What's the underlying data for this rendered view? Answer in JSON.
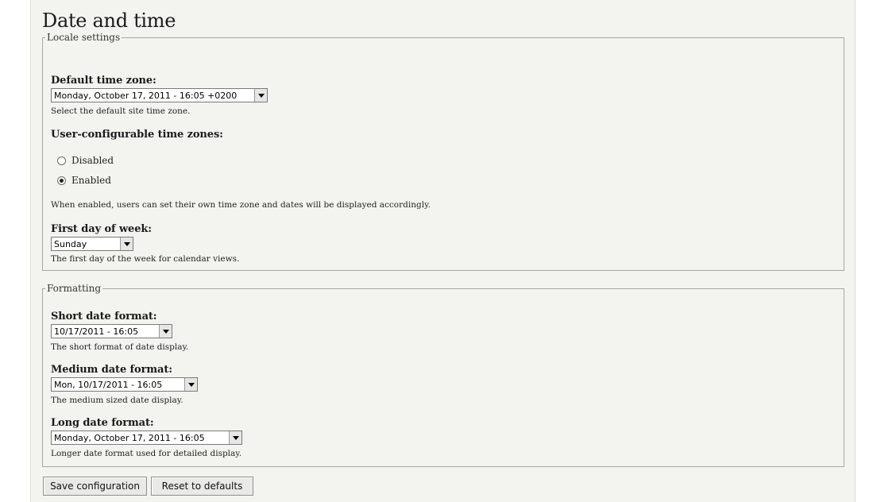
{
  "page": {
    "title": "Date and time"
  },
  "locale": {
    "legend": "Locale settings",
    "default_timezone": {
      "label": "Default time zone:",
      "value": "Monday, October 17, 2011 - 16:05 +0200",
      "description": "Select the default site time zone."
    },
    "user_timezones": {
      "label": "User-configurable time zones:",
      "options": [
        {
          "label": "Disabled",
          "checked": false
        },
        {
          "label": "Enabled",
          "checked": true
        }
      ],
      "description": "When enabled, users can set their own time zone and dates will be displayed accordingly."
    },
    "first_day": {
      "label": "First day of week:",
      "value": "Sunday",
      "description": "The first day of the week for calendar views."
    }
  },
  "formatting": {
    "legend": "Formatting",
    "short": {
      "label": "Short date format:",
      "value": "10/17/2011 - 16:05",
      "description": "The short format of date display."
    },
    "medium": {
      "label": "Medium date format:",
      "value": "Mon, 10/17/2011 - 16:05",
      "description": "The medium sized date display."
    },
    "long": {
      "label": "Long date format:",
      "value": "Monday, October 17, 2011 - 16:05",
      "description": "Longer date format used for detailed display."
    }
  },
  "actions": {
    "save_label": "Save configuration",
    "reset_label": "Reset to defaults"
  },
  "icons": {
    "dropdown": "chevron-down-icon"
  }
}
